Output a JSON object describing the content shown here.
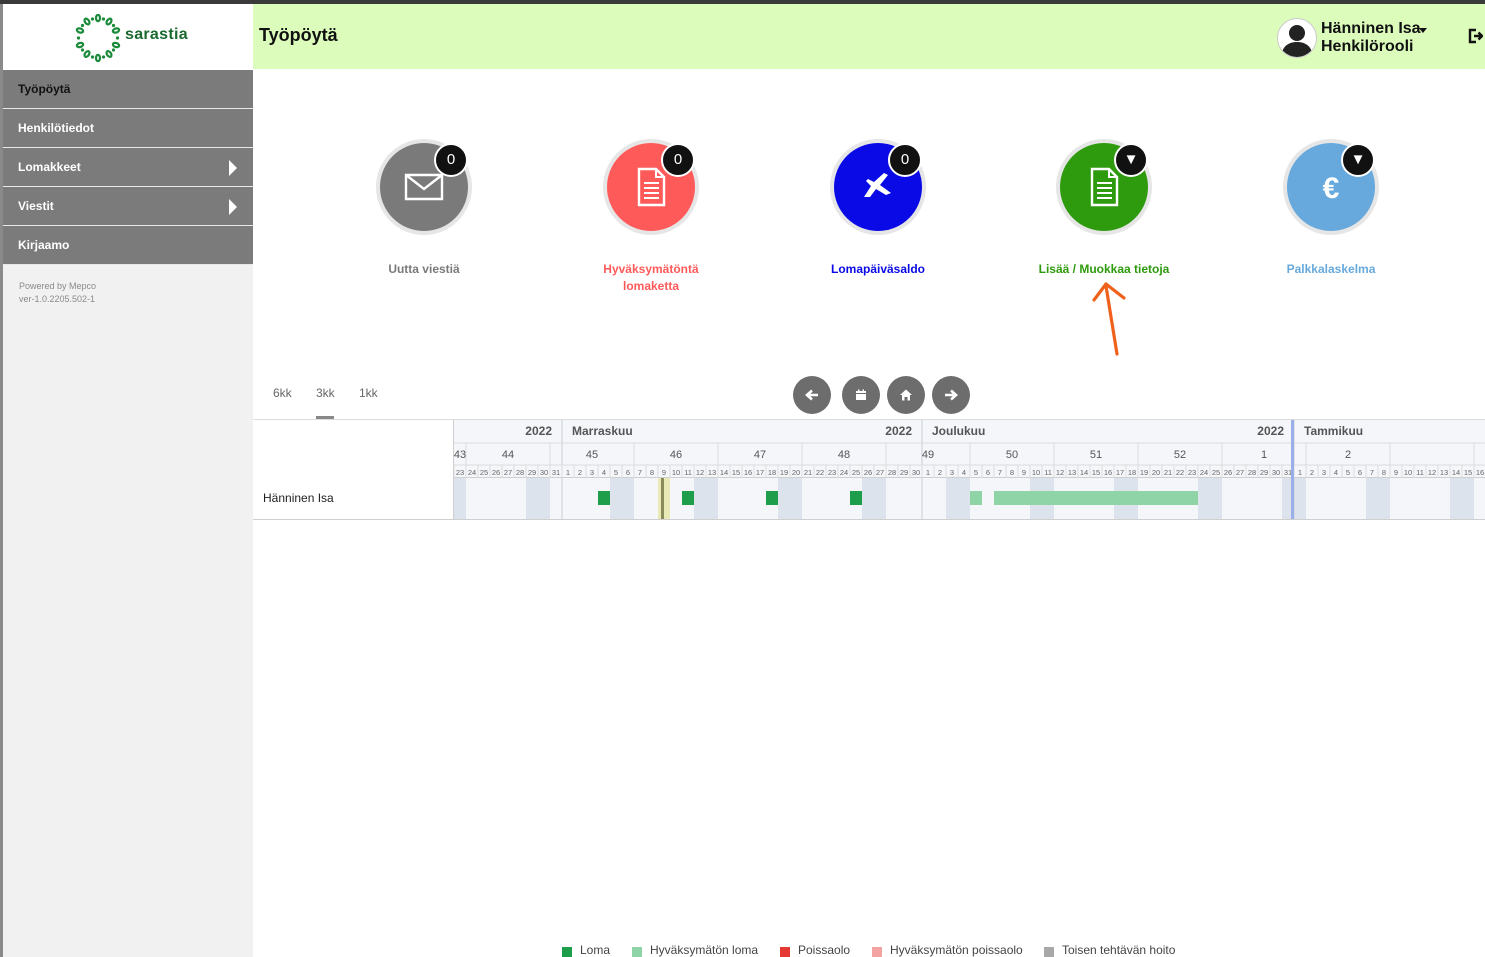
{
  "brand": {
    "name": "sarastia",
    "powered_by": "Powered by Mepco",
    "version": "ver-1.0.2205.502-1"
  },
  "sidebar": {
    "items": [
      {
        "label": "Työpöytä",
        "active": true,
        "submenu": false
      },
      {
        "label": "Henkilötiedot",
        "active": false,
        "submenu": false
      },
      {
        "label": "Lomakkeet",
        "active": false,
        "submenu": true
      },
      {
        "label": "Viestit",
        "active": false,
        "submenu": true
      },
      {
        "label": "Kirjaamo",
        "active": false,
        "submenu": false
      }
    ]
  },
  "header": {
    "title": "Työpöytä",
    "user_name": "Hänninen Isa",
    "user_role": "Henkilörooli"
  },
  "tiles": [
    {
      "label": "Uutta viestiä",
      "badge": "0",
      "icon": "envelope-icon",
      "color": "#7a7a7a"
    },
    {
      "label": "Hyväksymätöntä lomaketta",
      "badge": "0",
      "icon": "document-icon",
      "color": "#ff5a5a"
    },
    {
      "label": "Lomapäiväsaldo",
      "badge": "0",
      "icon": "airplane-icon",
      "color": "#0a0ae6"
    },
    {
      "label": "Lisää / Muokkaa tietoja",
      "badge": "▼",
      "icon": "document-icon",
      "color": "#2e9b0e"
    },
    {
      "label": "Palkkalaskelma",
      "badge": "▼",
      "icon": "euro-icon",
      "color": "#67a9dc"
    }
  ],
  "timeline": {
    "scales": [
      "6kk",
      "3kk",
      "1kk"
    ],
    "selected_scale": "3kk",
    "months": [
      {
        "name": "",
        "year": "2022"
      },
      {
        "name": "Marraskuu",
        "year": "2022"
      },
      {
        "name": "Joulukuu",
        "year": "2022"
      },
      {
        "name": "Tammikuu",
        "year": ""
      }
    ],
    "weeks": [
      "43",
      "44",
      "45",
      "46",
      "47",
      "48",
      "49",
      "50",
      "51",
      "52",
      "1",
      "2"
    ],
    "days": [
      "23",
      "24",
      "25",
      "26",
      "27",
      "28",
      "29",
      "30",
      "31",
      "1",
      "2",
      "3",
      "4",
      "5",
      "6",
      "7",
      "8",
      "9",
      "10",
      "11",
      "12",
      "13",
      "14",
      "15",
      "16",
      "17",
      "18",
      "19",
      "20",
      "21",
      "22",
      "23",
      "24",
      "25",
      "26",
      "27",
      "28",
      "29",
      "30",
      "1",
      "2",
      "3",
      "4",
      "5",
      "6",
      "7",
      "8",
      "9",
      "10",
      "11",
      "12",
      "13",
      "14",
      "15",
      "16",
      "17",
      "18",
      "19",
      "20",
      "21",
      "22",
      "23",
      "24",
      "25",
      "26",
      "27",
      "28",
      "29",
      "30",
      "31",
      "1",
      "2",
      "3",
      "4",
      "5",
      "6",
      "7",
      "8",
      "9",
      "10",
      "11",
      "12",
      "13",
      "14",
      "15",
      "16"
    ],
    "person": "Hänninen Isa",
    "events": [
      {
        "type": "Loma",
        "start": "2022-11-04",
        "end": "2022-11-04"
      },
      {
        "type": "Loma",
        "start": "2022-11-11",
        "end": "2022-11-11"
      },
      {
        "type": "Loma",
        "start": "2022-11-18",
        "end": "2022-11-18"
      },
      {
        "type": "Loma",
        "start": "2022-11-25",
        "end": "2022-11-25"
      },
      {
        "type": "Hyväksymätön loma",
        "start": "2022-12-05",
        "end": "2022-12-05"
      },
      {
        "type": "Hyväksymätön loma",
        "start": "2022-12-07",
        "end": "2022-12-23"
      }
    ]
  },
  "legend": [
    {
      "label": "Loma",
      "color": "#1e9e4a"
    },
    {
      "label": "Hyväksymätön loma",
      "color": "#8fd4a6"
    },
    {
      "label": "Poissaolo",
      "color": "#e53935"
    },
    {
      "label": "Hyväksymätön poissaolo",
      "color": "#f4a3a3"
    },
    {
      "label": "Toisen tehtävän hoito",
      "color": "#a8a8a8"
    }
  ]
}
